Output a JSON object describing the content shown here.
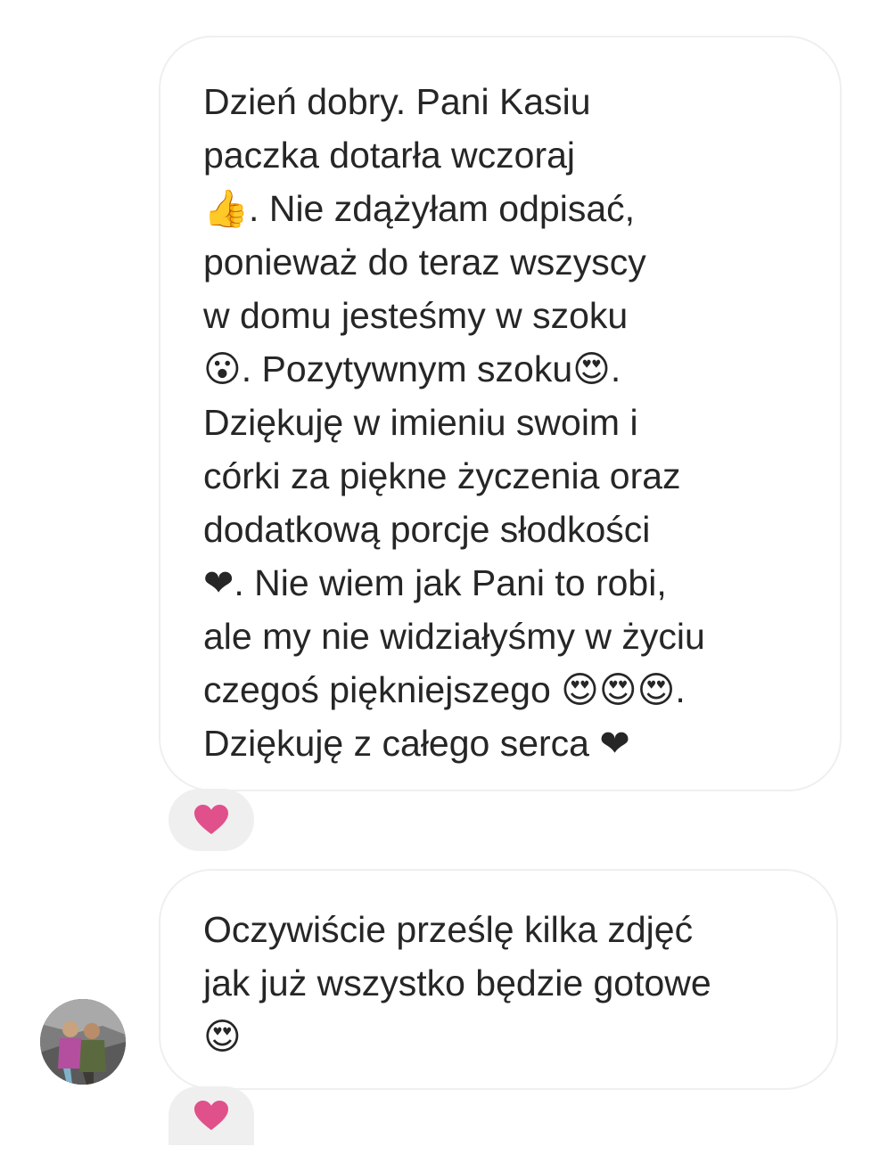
{
  "messages": [
    {
      "text": "Dzień dobry. Pani Kasiu\npaczka dotarła wczoraj\n👍. Nie zdążyłam odpisać,\nponieważ do teraz wszyscy\nw domu jesteśmy w szoku\n😮. Pozytywnym szoku😍.\nDziękuję w imieniu swoim i\ncórki za piękne życzenia oraz\ndodatkową porcje słodkości\n❤. Nie wiem jak Pani to robi,\nale my nie widziałyśmy w życiu\nczegoś piękniejszego 😍😍😍.\nDziękuję z całego serca ❤",
      "reaction": "heart-icon"
    },
    {
      "text": "Oczywiście prześlę kilka zdjęć\njak już wszystko będzie gotowe\n😍",
      "reaction": "heart-icon"
    }
  ],
  "colors": {
    "bubble_border": "#efefef",
    "reaction_bg": "#efefef",
    "heart": "#e0508a",
    "text": "#262626"
  }
}
